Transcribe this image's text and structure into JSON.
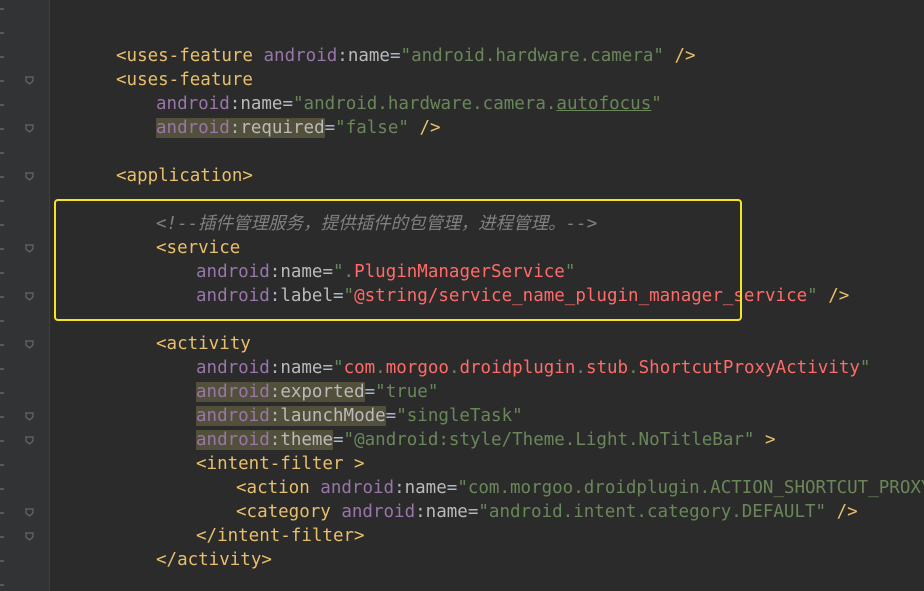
{
  "editor": {
    "lines": [
      {
        "indent": 1,
        "tokens": [
          {
            "c": "t",
            "x": "<uses-feature "
          },
          {
            "c": "ns",
            "x": "android"
          },
          {
            "c": "p",
            "x": ":"
          },
          {
            "c": "at",
            "x": "name"
          },
          {
            "c": "p",
            "x": "="
          },
          {
            "c": "v",
            "x": "\"android.hardware.camera\""
          },
          {
            "c": "t",
            "x": " />"
          }
        ]
      },
      {
        "indent": 1,
        "tokens": [
          {
            "c": "t",
            "x": "<uses-feature"
          }
        ]
      },
      {
        "indent": 2,
        "tokens": [
          {
            "c": "ns",
            "x": "android"
          },
          {
            "c": "p",
            "x": ":"
          },
          {
            "c": "at",
            "x": "name"
          },
          {
            "c": "p",
            "x": "="
          },
          {
            "c": "v",
            "x": "\"android.hardware.camera."
          },
          {
            "c": "v ul",
            "x": "autofocus"
          },
          {
            "c": "v",
            "x": "\""
          }
        ]
      },
      {
        "indent": 2,
        "tokens": [
          {
            "c": "ns hl",
            "x": "android"
          },
          {
            "c": "p hl",
            "x": ":"
          },
          {
            "c": "at hl",
            "x": "required"
          },
          {
            "c": "p",
            "x": "="
          },
          {
            "c": "v",
            "x": "\"false\""
          },
          {
            "c": "t",
            "x": " />"
          }
        ]
      },
      {
        "indent": 0,
        "tokens": []
      },
      {
        "indent": 1,
        "tokens": [
          {
            "c": "t",
            "x": "<application>"
          }
        ]
      },
      {
        "indent": 0,
        "tokens": []
      },
      {
        "indent": 2,
        "tokens": [
          {
            "c": "cm",
            "x": "<!--插件管理服务，提供插件的包管理，进程管理。-->"
          }
        ]
      },
      {
        "indent": 2,
        "tokens": [
          {
            "c": "t",
            "x": "<service"
          }
        ]
      },
      {
        "indent": 3,
        "tokens": [
          {
            "c": "ns",
            "x": "android"
          },
          {
            "c": "p",
            "x": ":"
          },
          {
            "c": "at",
            "x": "name"
          },
          {
            "c": "p",
            "x": "="
          },
          {
            "c": "v",
            "x": "\"."
          },
          {
            "c": "vr",
            "x": "PluginManagerService"
          },
          {
            "c": "v",
            "x": "\""
          }
        ]
      },
      {
        "indent": 3,
        "tokens": [
          {
            "c": "ns",
            "x": "android"
          },
          {
            "c": "p",
            "x": ":"
          },
          {
            "c": "at",
            "x": "label"
          },
          {
            "c": "p",
            "x": "="
          },
          {
            "c": "v",
            "x": "\""
          },
          {
            "c": "vr",
            "x": "@string/service_name_plugin_manager_service"
          },
          {
            "c": "v",
            "x": "\""
          },
          {
            "c": "t",
            "x": " />"
          }
        ]
      },
      {
        "indent": 0,
        "tokens": []
      },
      {
        "indent": 2,
        "tokens": [
          {
            "c": "t",
            "x": "<activity"
          }
        ]
      },
      {
        "indent": 3,
        "tokens": [
          {
            "c": "ns",
            "x": "android"
          },
          {
            "c": "p",
            "x": ":"
          },
          {
            "c": "at",
            "x": "name"
          },
          {
            "c": "p",
            "x": "="
          },
          {
            "c": "v",
            "x": "\""
          },
          {
            "c": "vr",
            "x": "com"
          },
          {
            "c": "v",
            "x": "."
          },
          {
            "c": "vr",
            "x": "morgoo"
          },
          {
            "c": "v",
            "x": "."
          },
          {
            "c": "vr",
            "x": "droidplugin"
          },
          {
            "c": "v",
            "x": "."
          },
          {
            "c": "vr",
            "x": "stub"
          },
          {
            "c": "v",
            "x": "."
          },
          {
            "c": "vr",
            "x": "ShortcutProxyActivity"
          },
          {
            "c": "v",
            "x": "\""
          }
        ]
      },
      {
        "indent": 3,
        "tokens": [
          {
            "c": "ns hl",
            "x": "android"
          },
          {
            "c": "p hl",
            "x": ":"
          },
          {
            "c": "at hl",
            "x": "exported"
          },
          {
            "c": "p",
            "x": "="
          },
          {
            "c": "v",
            "x": "\"true\""
          }
        ]
      },
      {
        "indent": 3,
        "tokens": [
          {
            "c": "ns hl",
            "x": "android"
          },
          {
            "c": "p hl",
            "x": ":"
          },
          {
            "c": "at hl",
            "x": "launchMode"
          },
          {
            "c": "p",
            "x": "="
          },
          {
            "c": "v",
            "x": "\"singleTask\""
          }
        ]
      },
      {
        "indent": 3,
        "tokens": [
          {
            "c": "ns hl",
            "x": "android"
          },
          {
            "c": "p hl",
            "x": ":"
          },
          {
            "c": "at hl",
            "x": "theme"
          },
          {
            "c": "p",
            "x": "="
          },
          {
            "c": "v",
            "x": "\"@android:style/Theme.Light.NoTitleBar\""
          },
          {
            "c": "t",
            "x": " >"
          }
        ]
      },
      {
        "indent": 3,
        "tokens": [
          {
            "c": "t",
            "x": "<intent-filter >"
          }
        ]
      },
      {
        "indent": 4,
        "tokens": [
          {
            "c": "t",
            "x": "<action "
          },
          {
            "c": "ns",
            "x": "android"
          },
          {
            "c": "p",
            "x": ":"
          },
          {
            "c": "at",
            "x": "name"
          },
          {
            "c": "p",
            "x": "="
          },
          {
            "c": "v",
            "x": "\"com.morgoo.droidplugin.ACTION_SHORTCUT_PROXY\""
          },
          {
            "c": "t",
            "x": "/>"
          }
        ]
      },
      {
        "indent": 4,
        "tokens": [
          {
            "c": "t",
            "x": "<category "
          },
          {
            "c": "ns",
            "x": "android"
          },
          {
            "c": "p",
            "x": ":"
          },
          {
            "c": "at",
            "x": "name"
          },
          {
            "c": "p",
            "x": "="
          },
          {
            "c": "v",
            "x": "\"android.intent.category.DEFAULT\""
          },
          {
            "c": "t",
            "x": " />"
          }
        ]
      },
      {
        "indent": 3,
        "tokens": [
          {
            "c": "t",
            "x": "</intent-filter>"
          }
        ]
      },
      {
        "indent": 2,
        "tokens": [
          {
            "c": "t",
            "x": "</activity>"
          }
        ]
      }
    ]
  },
  "colors": {
    "background": "#2b2b2b",
    "gutter": "#313335",
    "tag": "#e8bf6a",
    "namespace": "#9876aa",
    "attribute": "#bababa",
    "string": "#6a8759",
    "resource_ref": "#ff6b68",
    "comment": "#808080",
    "highlight_box": "#f5e421"
  },
  "icons": {
    "fold_marker": "fold-marker-icon"
  }
}
